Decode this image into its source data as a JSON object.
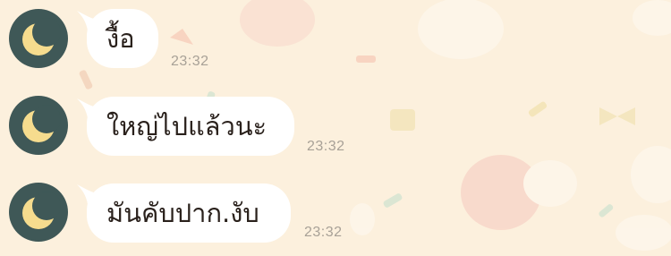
{
  "chat": {
    "messages": [
      {
        "text": "งื้อ",
        "time": "23:32",
        "avatar_icon": "crescent-moon-icon"
      },
      {
        "text": "ใหญ่ไปแล้วนะ",
        "time": "23:32",
        "avatar_icon": "crescent-moon-icon"
      },
      {
        "text": "มันคับปาก.งับ",
        "time": "23:32",
        "avatar_icon": "crescent-moon-icon"
      }
    ]
  },
  "colors": {
    "background": "#fcf0dd",
    "bubble": "#ffffff",
    "avatar": "#3f5857",
    "moon": "#f6dc8e",
    "timestamp": "#a8a197"
  }
}
